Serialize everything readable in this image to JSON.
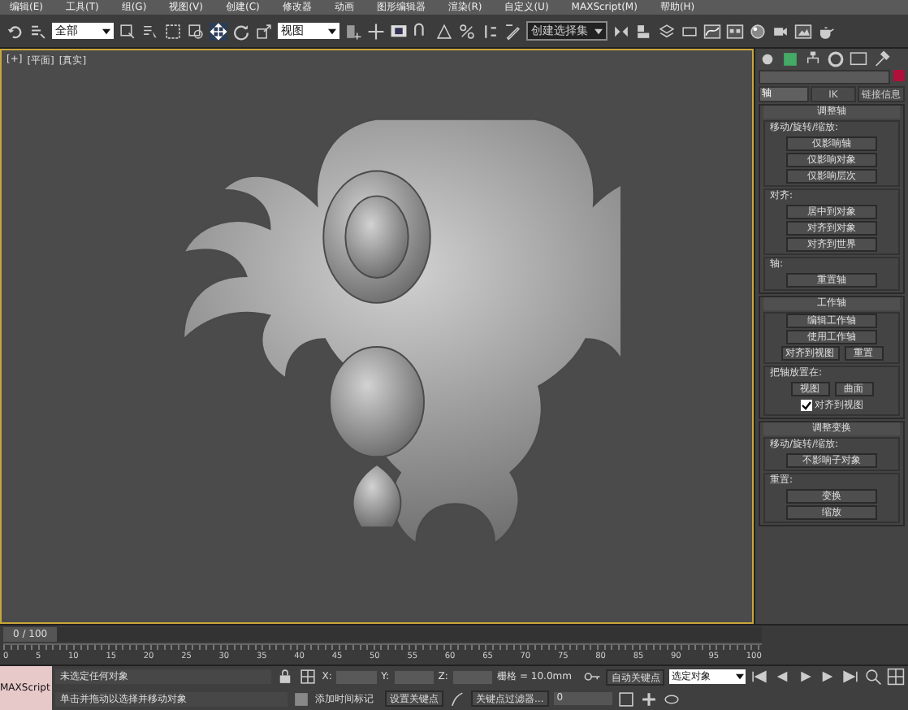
{
  "menu": [
    "编辑(E)",
    "工具(T)",
    "组(G)",
    "视图(V)",
    "创建(C)",
    "修改器",
    "动画",
    "图形编辑器",
    "渲染(R)",
    "自定义(U)",
    "MAXScript(M)",
    "帮助(H)"
  ],
  "toolbar": {
    "selection_filter": "全部",
    "reference_coordinate": "视图",
    "named_selection": "创建选择集"
  },
  "viewport": {
    "labels": [
      "[+]",
      "[平面]",
      "[真实]"
    ]
  },
  "command_panel": {
    "tabs": [
      {
        "label": "轴",
        "selected": true
      },
      {
        "label": "IK",
        "selected": false
      },
      {
        "label": "链接信息",
        "selected": false
      }
    ],
    "rollouts": [
      {
        "title": "调整轴",
        "groups": [
          {
            "title": "移动/旋转/缩放:",
            "items": [
              {
                "kind": "button",
                "label": "仅影响轴"
              },
              {
                "kind": "button",
                "label": "仅影响对象"
              },
              {
                "kind": "button",
                "label": "仅影响层次"
              }
            ]
          },
          {
            "title": "对齐:",
            "items": [
              {
                "kind": "button",
                "label": "居中到对象"
              },
              {
                "kind": "button",
                "label": "对齐到对象"
              },
              {
                "kind": "button",
                "label": "对齐到世界"
              }
            ]
          },
          {
            "title": "轴:",
            "items": [
              {
                "kind": "button",
                "label": "重置轴"
              }
            ]
          }
        ]
      },
      {
        "title": "工作轴",
        "groups": [
          {
            "items": [
              {
                "kind": "button",
                "label": "编辑工作轴"
              },
              {
                "kind": "button",
                "label": "使用工作轴"
              },
              {
                "kind": "pair",
                "labels": [
                  "对齐到视图",
                  "重置"
                ]
              }
            ]
          },
          {
            "title": "把轴放置在:",
            "items": [
              {
                "kind": "pair",
                "labels": [
                  "视图",
                  "曲面"
                ]
              },
              {
                "kind": "checkbox",
                "label": "对齐到视图",
                "checked": true
              }
            ]
          }
        ]
      },
      {
        "title": "调整变换",
        "groups": [
          {
            "title": "移动/旋转/缩放:",
            "items": [
              {
                "kind": "button",
                "label": "不影响子对象"
              }
            ]
          },
          {
            "title": "重置:",
            "items": [
              {
                "kind": "button",
                "label": "变换"
              },
              {
                "kind": "button",
                "label": "缩放"
              }
            ]
          }
        ]
      }
    ]
  },
  "timeline": {
    "frame": "0 / 100",
    "level": 0,
    "ticks": [
      "0",
      "5",
      "10",
      "15",
      "20",
      "25",
      "30",
      "35",
      "40",
      "45",
      "50",
      "55",
      "60",
      "65",
      "70",
      "75",
      "80",
      "85",
      "90",
      "95",
      "100"
    ]
  },
  "status": {
    "listener": "MAXScript",
    "selection": "未选定任何对象",
    "prompt": "单击并拖动以选择并移动对象",
    "axes": [
      "X:",
      "Y:",
      "Z:"
    ],
    "grid": "栅格 = 10.0mm",
    "time_tag": "添加时间标记",
    "auto_key": "自动关键点",
    "key_set": "选定对象",
    "set_key": "设置关键点",
    "key_filters": "关键点过滤器...",
    "current_frame": "0"
  }
}
